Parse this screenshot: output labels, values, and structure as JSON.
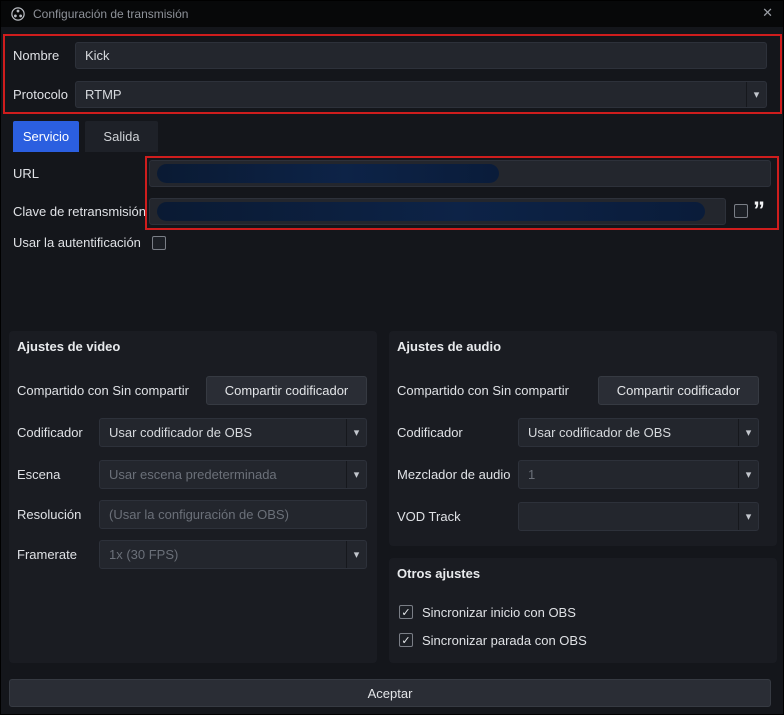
{
  "colors": {
    "accent": "#2b5fe0",
    "annotation": "#cf1d1d"
  },
  "icons": {
    "check": "✓",
    "chevron": "▾",
    "close": "✕",
    "quote": "”"
  },
  "titlebar": {
    "title": "Configuración de transmisión"
  },
  "header": {
    "nombre_label": "Nombre",
    "nombre_value": "Kick",
    "protocolo_label": "Protocolo",
    "protocolo_value": "RTMP"
  },
  "tabs": {
    "servicio": "Servicio",
    "salida": "Salida"
  },
  "service": {
    "url_label": "URL",
    "key_label": "Clave de retransmisión",
    "auth_label": "Usar la autentificación"
  },
  "video": {
    "title": "Ajustes de video",
    "shared_text": "Compartido con Sin compartir",
    "share_button": "Compartir codificador",
    "codificador_label": "Codificador",
    "codificador_value": "Usar codificador de OBS",
    "escena_label": "Escena",
    "escena_value": "Usar escena predeterminada",
    "resolucion_label": "Resolución",
    "resolucion_placeholder": "(Usar la configuración de OBS)",
    "framerate_label": "Framerate",
    "framerate_value": "1x (30 FPS)"
  },
  "audio": {
    "title": "Ajustes de audio",
    "shared_text": "Compartido con Sin compartir",
    "share_button": "Compartir codificador",
    "codificador_label": "Codificador",
    "codificador_value": "Usar codificador de OBS",
    "mezclador_label": "Mezclador de audio",
    "mezclador_value": "1",
    "vod_label": "VOD Track",
    "vod_value": ""
  },
  "otros": {
    "title": "Otros ajustes",
    "sync_start": "Sincronizar inicio con OBS",
    "sync_stop": "Sincronizar parada con OBS"
  },
  "footer": {
    "accept_button": "Aceptar"
  }
}
